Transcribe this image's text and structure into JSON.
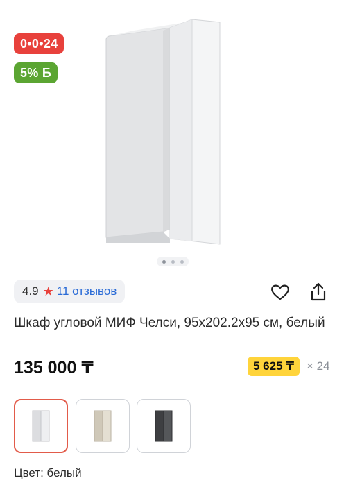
{
  "badges": {
    "installment": "0•0•24",
    "bonus": "5% Б"
  },
  "gallery": {
    "image_count": 3,
    "active_index": 0
  },
  "rating": {
    "value": "4.9",
    "reviews": "11 отзывов"
  },
  "product": {
    "title": "Шкаф угловой МИФ Челси, 95x202.2x95 см, белый",
    "price": "135 000 ₸",
    "monthly_payment": "5 625 ₸",
    "months": "× 24"
  },
  "variants": [
    {
      "name": "белый",
      "color": "#e9eaec",
      "selected": true
    },
    {
      "name": "beige",
      "color": "#d8d2c4",
      "selected": false
    },
    {
      "name": "dark",
      "color": "#4a4b4e",
      "selected": false
    }
  ],
  "color_label": "Цвет: белый",
  "colors": {
    "installment_badge": "#e8413c",
    "bonus_badge": "#5ba532",
    "star": "#e8413c",
    "link": "#2a6bd6",
    "installment_pill": "#ffd43b",
    "selected_border": "#e25b4a"
  }
}
